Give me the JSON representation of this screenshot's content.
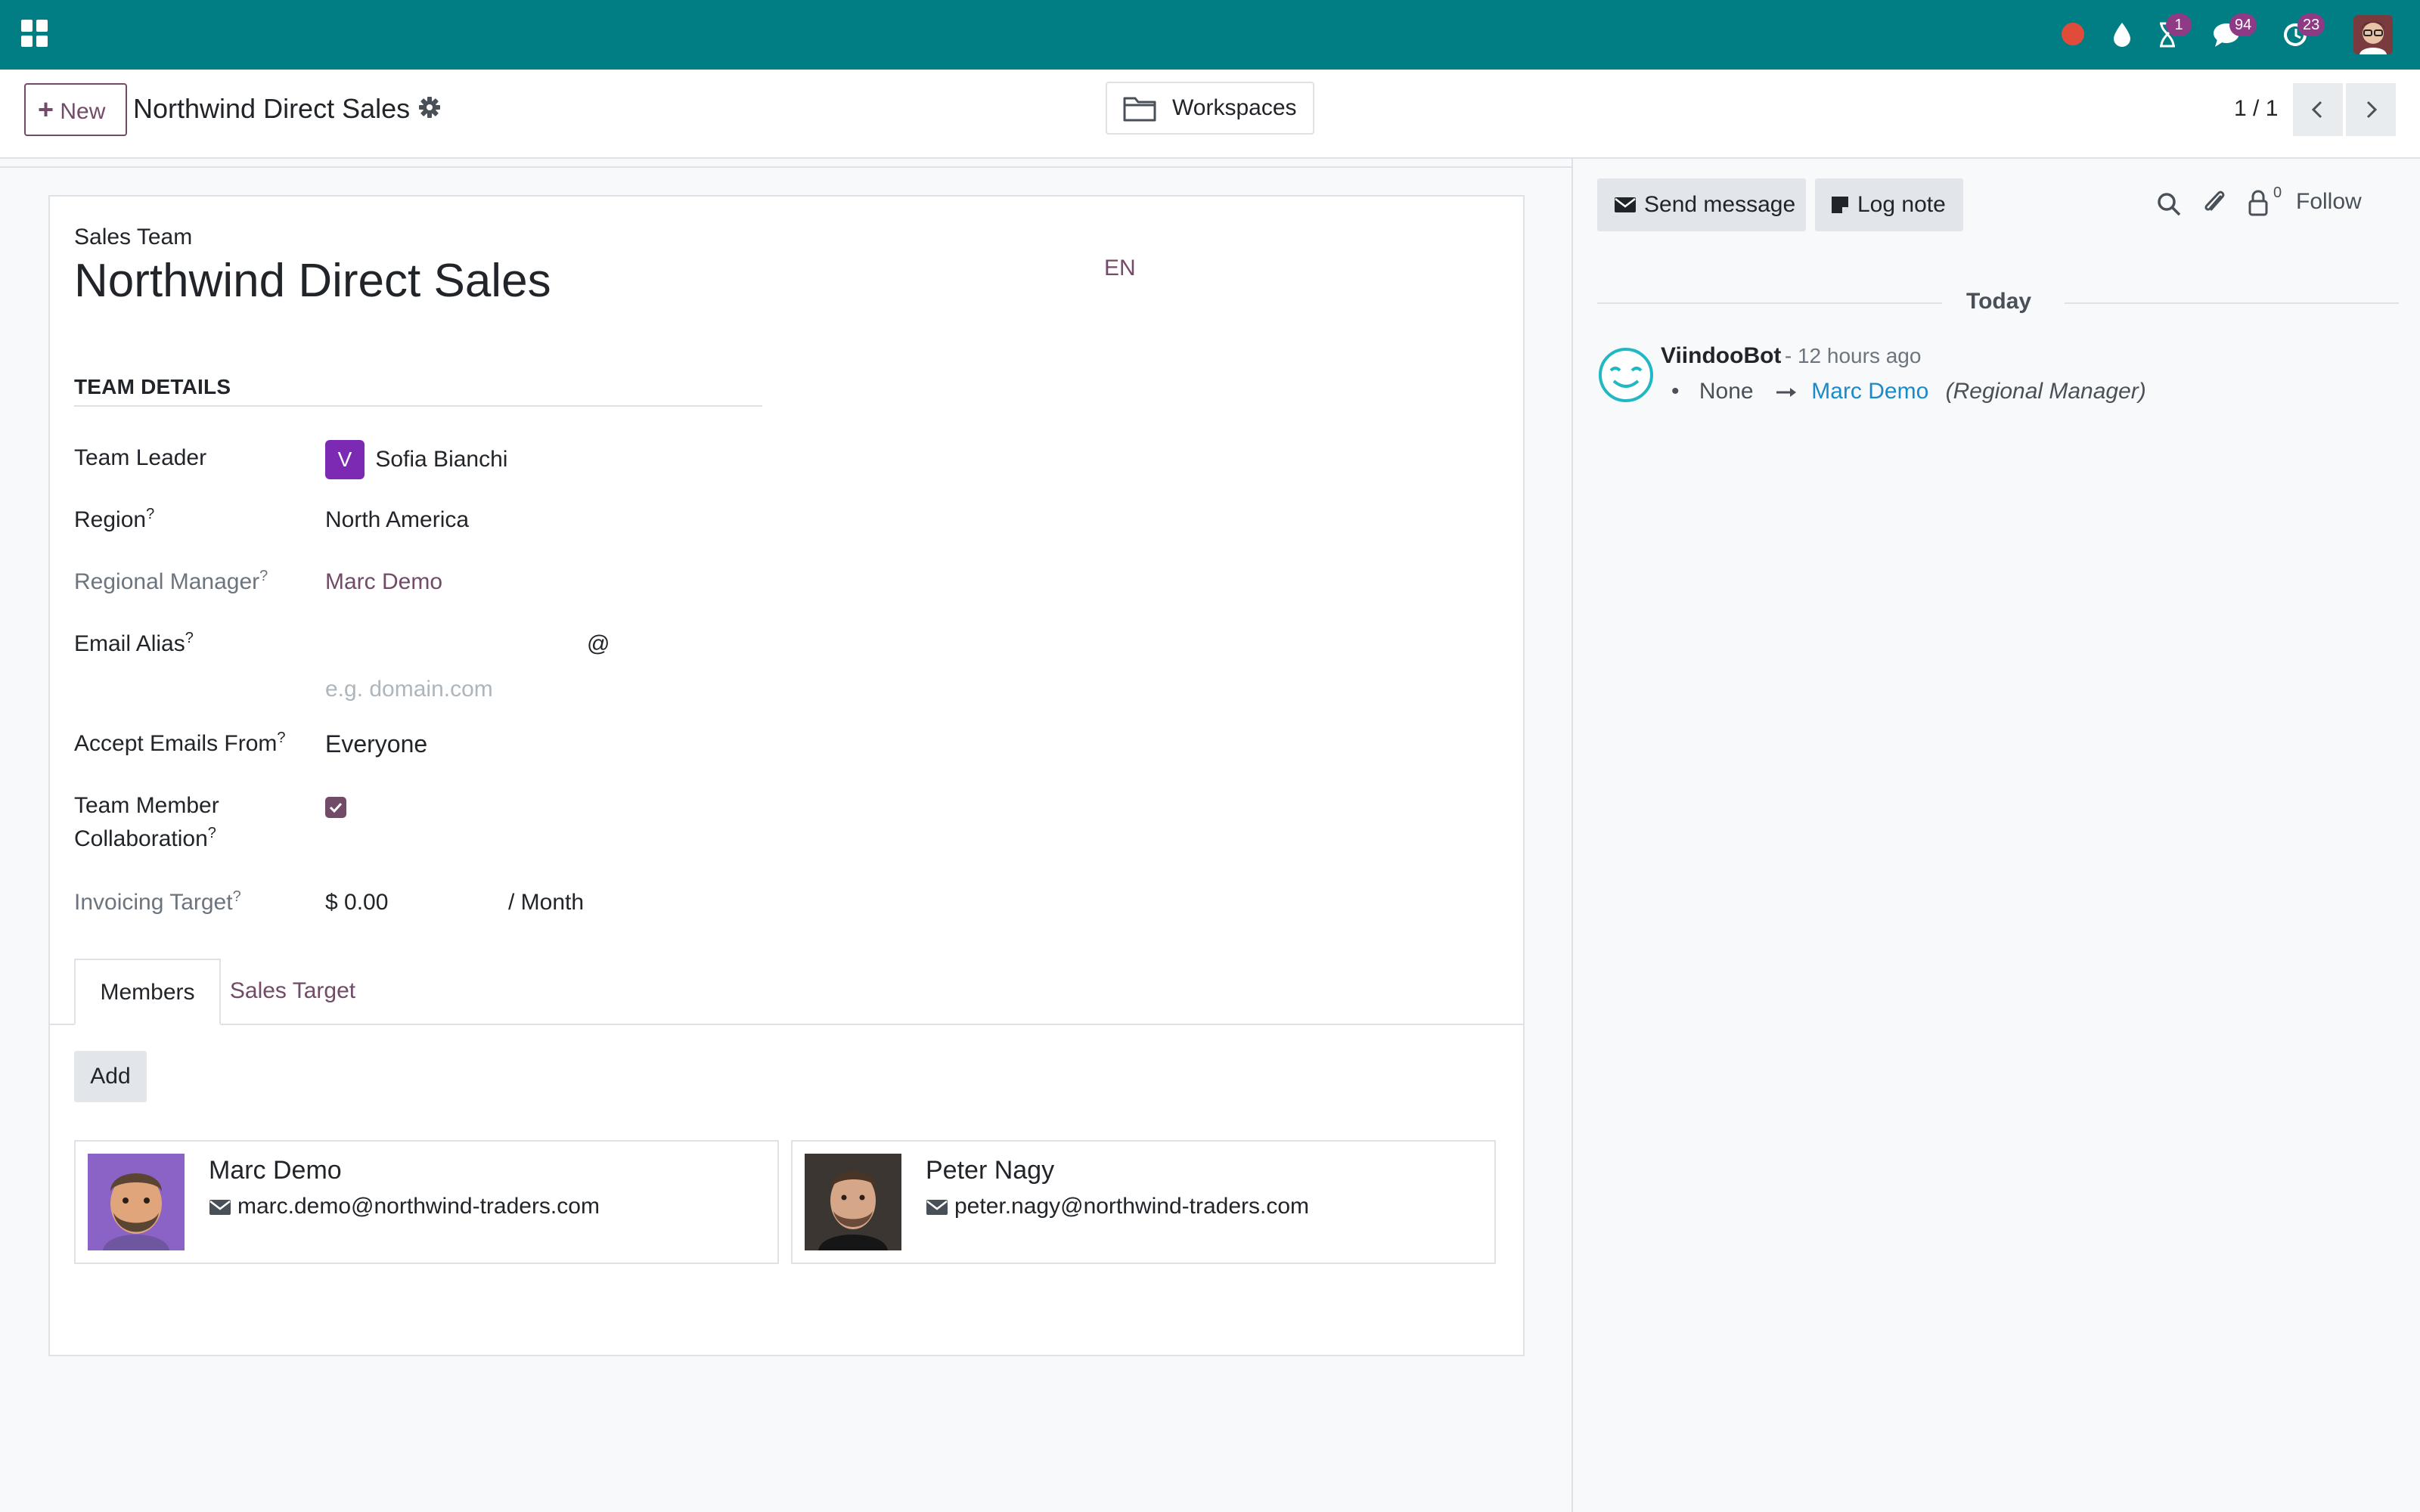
{
  "navbar": {
    "badges": {
      "activity": "1",
      "messages": "94",
      "updates": "23"
    },
    "colors": {
      "bar": "#017e84",
      "badge": "#8f3a84",
      "recording": "#e04b3a"
    }
  },
  "control_panel": {
    "new_label": "New",
    "breadcrumb": "Northwind Direct Sales",
    "workspaces_label": "Workspaces",
    "pager": "1 / 1"
  },
  "form": {
    "record_type": "Sales Team",
    "name": "Northwind Direct Sales",
    "lang": "EN",
    "section_title": "TEAM DETAILS",
    "fields": {
      "team_leader": {
        "label": "Team Leader",
        "avatar_letter": "V",
        "value": "Sofia Bianchi"
      },
      "region": {
        "label": "Region",
        "help": "?",
        "value": "North America"
      },
      "regional_manager": {
        "label": "Regional Manager",
        "help": "?",
        "value": "Marc Demo"
      },
      "email_alias": {
        "label": "Email Alias",
        "help": "?",
        "at": "@",
        "domain_placeholder": "e.g. domain.com"
      },
      "accept_emails": {
        "label": "Accept Emails From",
        "help": "?",
        "value": "Everyone"
      },
      "collaboration": {
        "label_line1": "Team Member",
        "label_line2": "Collaboration",
        "help": "?",
        "checked": true
      },
      "invoicing_target": {
        "label": "Invoicing Target",
        "help": "?",
        "value": "$ 0.00",
        "period": "/ Month"
      }
    },
    "tabs": [
      {
        "label": "Members",
        "active": true
      },
      {
        "label": "Sales Target",
        "active": false
      }
    ],
    "add_label": "Add",
    "members": [
      {
        "name": "Marc Demo",
        "email": "marc.demo@northwind-traders.com"
      },
      {
        "name": "Peter Nagy",
        "email": "peter.nagy@northwind-traders.com"
      }
    ]
  },
  "chatter": {
    "send_message": "Send message",
    "log_note": "Log note",
    "followers_count": "0",
    "follow_label": "Follow",
    "date_separator": "Today",
    "message": {
      "author": "ViindooBot",
      "time": "- 12 hours ago",
      "old_value": "None",
      "new_value": "Marc Demo",
      "field": "(Regional Manager)"
    }
  }
}
